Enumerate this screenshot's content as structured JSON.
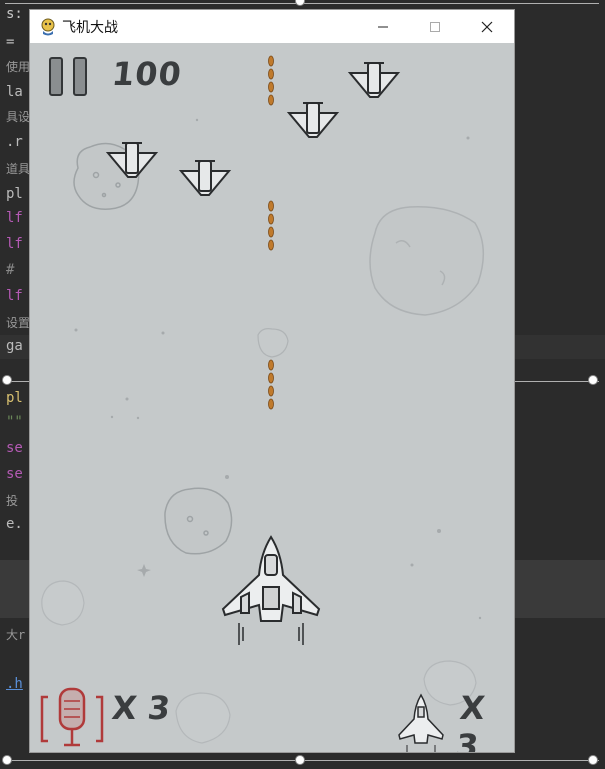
{
  "window": {
    "title": "飞机大战"
  },
  "hud": {
    "score": "100",
    "bomb_count": "X 3",
    "lives_count": "X 3"
  },
  "ide_background": {
    "fragments": [
      "s:",
      " =",
      "使用",
      "la",
      "具设",
      ".r",
      "道具",
      "pl",
      "lf",
      "lf",
      " #",
      "lf",
      "设置",
      "ga",
      "pl",
      "\"\"",
      "se",
      "se",
      " 投",
      "e.",
      "大r",
      ".h"
    ]
  },
  "colors": {
    "sky": "#c5c9ca",
    "bullet": "#c07a2c",
    "bomb_icon": "#b03a3a",
    "ink": "#333638"
  },
  "icons": {
    "pause": "pause-icon",
    "bomb": "bomb-icon",
    "life": "life-plane-icon",
    "app": "pygame-snake-icon"
  }
}
